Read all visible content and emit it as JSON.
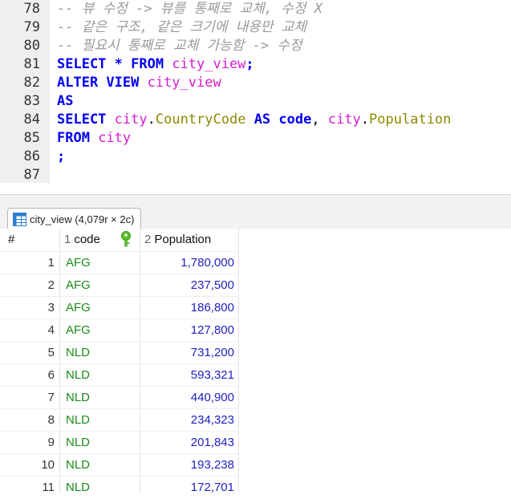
{
  "editor": {
    "lines": [
      {
        "num": "78",
        "tokens": [
          {
            "t": "-- 뷰 수정 -> 뷰를 통째로 교체, 수정 X",
            "c": "cm"
          }
        ]
      },
      {
        "num": "79",
        "tokens": [
          {
            "t": "-- 같은 구조, 같은 크기에 내용만 교체",
            "c": "cm"
          }
        ]
      },
      {
        "num": "80",
        "tokens": [
          {
            "t": "-- 필요시 통째로 교체 가능함 -> 수정",
            "c": "cm"
          }
        ]
      },
      {
        "num": "81",
        "tokens": [
          {
            "t": "SELECT * FROM ",
            "c": "kw"
          },
          {
            "t": "city_view",
            "c": "id"
          },
          {
            "t": ";",
            "c": "kw"
          }
        ]
      },
      {
        "num": "82",
        "tokens": [
          {
            "t": "ALTER VIEW ",
            "c": "kw"
          },
          {
            "t": "city_view",
            "c": "id"
          }
        ]
      },
      {
        "num": "83",
        "tokens": [
          {
            "t": "AS",
            "c": "kw"
          }
        ]
      },
      {
        "num": "84",
        "tokens": [
          {
            "t": "SELECT ",
            "c": "kw"
          },
          {
            "t": "city",
            "c": "id"
          },
          {
            "t": ".",
            "c": "plain"
          },
          {
            "t": "CountryCode",
            "c": "col"
          },
          {
            "t": " AS ",
            "c": "kw"
          },
          {
            "t": "code",
            "c": "kw"
          },
          {
            "t": ", ",
            "c": "plain"
          },
          {
            "t": "city",
            "c": "id"
          },
          {
            "t": ".",
            "c": "plain"
          },
          {
            "t": "Population",
            "c": "col"
          }
        ]
      },
      {
        "num": "85",
        "tokens": [
          {
            "t": "FROM ",
            "c": "kw"
          },
          {
            "t": "city",
            "c": "id"
          }
        ]
      },
      {
        "num": "86",
        "tokens": [
          {
            "t": ";",
            "c": "kw"
          }
        ]
      },
      {
        "num": "87",
        "tokens": []
      }
    ]
  },
  "results": {
    "tab_label": "city_view (4,079r × 2c)",
    "tab_icon": "table-grid-icon",
    "columns": {
      "index_header": "#",
      "col1_num": "1",
      "col1_name": "code",
      "col1_icon": "primary-key-icon",
      "col2_num": "2",
      "col2_name": "Population"
    },
    "rows": [
      {
        "idx": "1",
        "code": "AFG",
        "population": "1,780,000"
      },
      {
        "idx": "2",
        "code": "AFG",
        "population": "237,500"
      },
      {
        "idx": "3",
        "code": "AFG",
        "population": "186,800"
      },
      {
        "idx": "4",
        "code": "AFG",
        "population": "127,800"
      },
      {
        "idx": "5",
        "code": "NLD",
        "population": "731,200"
      },
      {
        "idx": "6",
        "code": "NLD",
        "population": "593,321"
      },
      {
        "idx": "7",
        "code": "NLD",
        "population": "440,900"
      },
      {
        "idx": "8",
        "code": "NLD",
        "population": "234,323"
      },
      {
        "idx": "9",
        "code": "NLD",
        "population": "201,843"
      },
      {
        "idx": "10",
        "code": "NLD",
        "population": "193,238"
      },
      {
        "idx": "11",
        "code": "NLD",
        "population": "172,701"
      }
    ]
  },
  "colors": {
    "keyword": "#0000ee",
    "identifier": "#d81cd0",
    "column": "#8a8a00",
    "comment": "#9a9a9a",
    "code_value": "#1b8a1b",
    "number_value": "#1f1fbf",
    "key_icon": "#5cc22a"
  }
}
